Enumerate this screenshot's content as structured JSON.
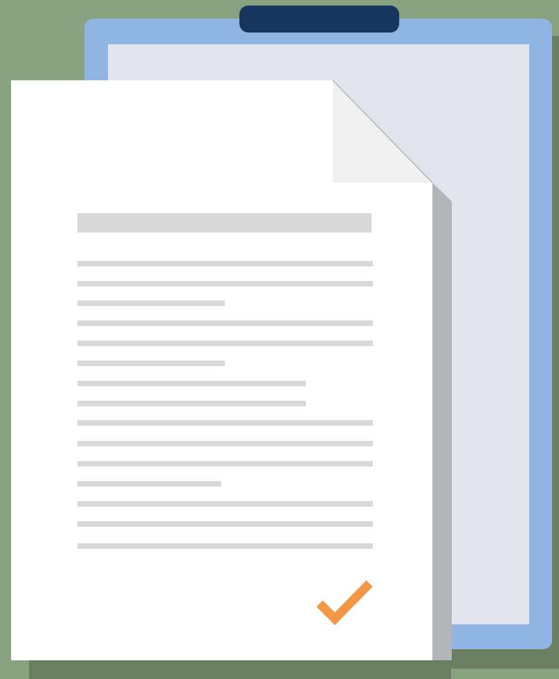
{
  "illustration": {
    "subject": "document-on-clipboard",
    "icons": [
      "clipboard-icon",
      "document-icon",
      "checkmark-icon"
    ],
    "document": {
      "heading_placeholder_count": 1,
      "text_line_placeholder_count": 15,
      "status": "approved"
    },
    "colors": {
      "background": "#88a17e",
      "background_shadow": "#6a7f62",
      "clipboard_board": "#8fb4e3",
      "clipboard_clip": "#17365f",
      "clipboard_paper": "#e1e4ed",
      "document_paper": "#ffffff",
      "document_fold": "#f0f0f0",
      "document_shadow": "#b4b5b9",
      "placeholder_line": "#d9d9d9",
      "checkmark": "#f39645"
    }
  }
}
